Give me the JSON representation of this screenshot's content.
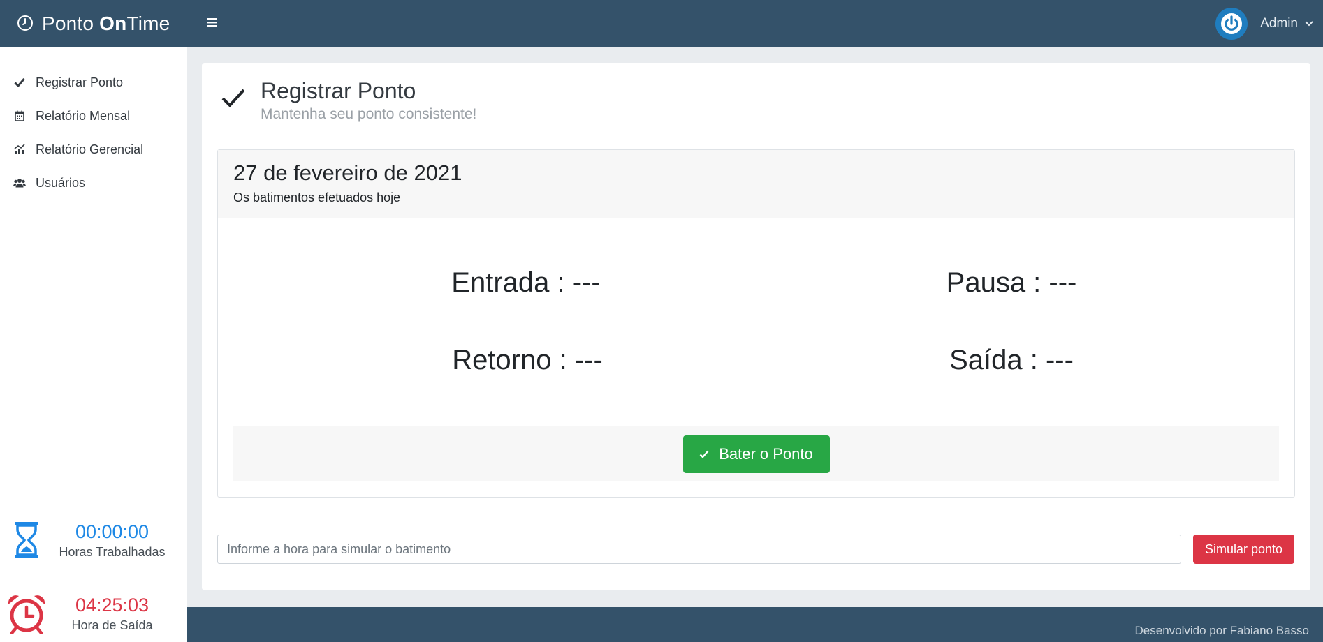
{
  "header": {
    "brand_prefix": "Ponto ",
    "brand_bold": "On",
    "brand_suffix": "Time",
    "user_name": "Admin"
  },
  "sidebar": {
    "items": [
      {
        "label": "Registrar Ponto",
        "icon": "check-icon"
      },
      {
        "label": "Relatório Mensal",
        "icon": "calendar-icon"
      },
      {
        "label": "Relatório Gerencial",
        "icon": "chart-icon"
      },
      {
        "label": "Usuários",
        "icon": "users-icon"
      }
    ],
    "worked": {
      "time": "00:00:00",
      "label": "Horas Trabalhadas",
      "color": "#1e88e5"
    },
    "exit": {
      "time": "04:25:03",
      "label": "Hora de Saída",
      "color": "#dc3545"
    }
  },
  "page": {
    "title": "Registrar Ponto",
    "subtitle": "Mantenha seu ponto consistente!"
  },
  "panel": {
    "date": "27 de fevereiro de 2021",
    "description": "Os batimentos efetuados hoje",
    "entrada": "Entrada : ---",
    "pausa": "Pausa : ---",
    "retorno": "Retorno : ---",
    "saida": "Saída : ---",
    "button_label": "Bater o Ponto"
  },
  "simulate": {
    "placeholder": "Informe a hora para simular o batimento",
    "button_label": "Simular ponto"
  },
  "footer": {
    "credit": "Desenvolvido por Fabiano Basso"
  },
  "colors": {
    "header": "#34526a",
    "success": "#28a745",
    "danger": "#dc3545",
    "accent_blue": "#1e88e5"
  }
}
